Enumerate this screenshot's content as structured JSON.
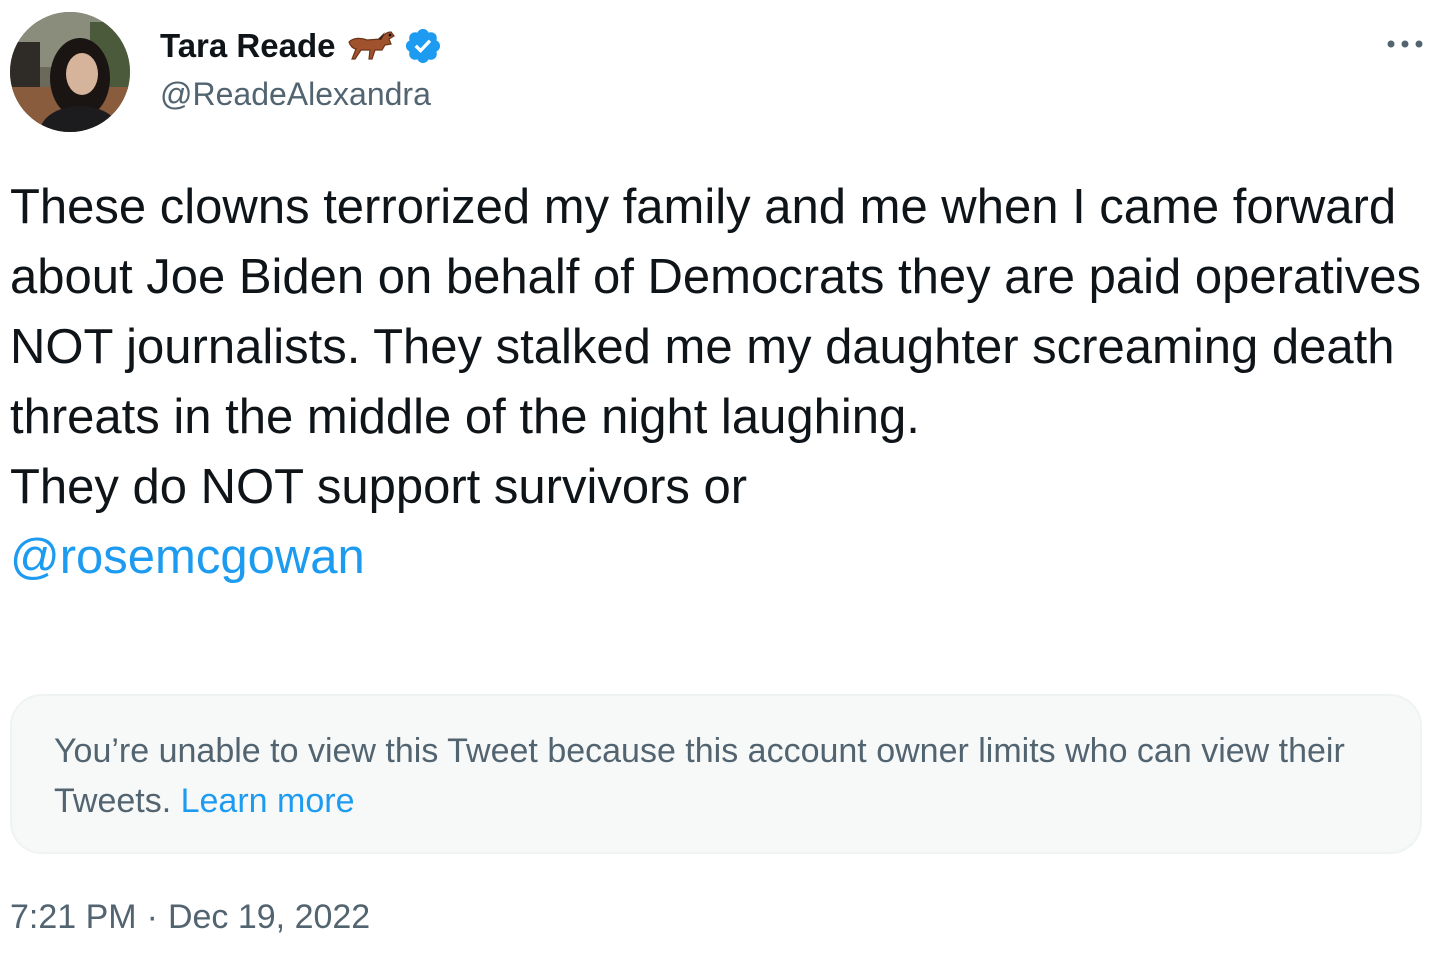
{
  "author": {
    "display_name": "Tara Reade",
    "name_emoji": "horse-emoji",
    "verified_icon": "verified-badge-icon",
    "handle": "@ReadeAlexandra",
    "avatar": "profile-photo"
  },
  "menu": {
    "icon": "more-options-icon"
  },
  "tweet": {
    "text": "These clowns terrorized my family and me when I came forward about Joe Biden on behalf of Democrats they are paid operatives NOT journalists. They stalked me my daughter screaming death threats in the middle of the night laughing.\nThey do NOT support survivors or\n",
    "mention": "@rosemcgowan"
  },
  "quoted_notice": {
    "text": "You’re unable to view this Tweet because this account owner limits who can view their Tweets. ",
    "link_label": "Learn more"
  },
  "meta": {
    "time": "7:21 PM",
    "separator": "·",
    "date": "Dec 19, 2022"
  },
  "colors": {
    "link": "#1d9bf0",
    "secondary_text": "#536471",
    "primary_text": "#0f1419",
    "notice_bg": "#f7f9f9"
  }
}
